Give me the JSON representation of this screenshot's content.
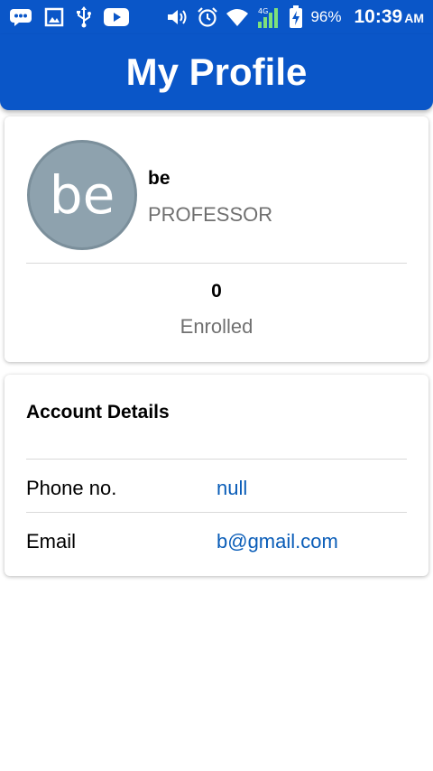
{
  "status_bar": {
    "battery_percent": "96%",
    "time": "10:39",
    "ampm": "AM",
    "signal_label": "4G",
    "icons_left": [
      "message-icon",
      "image-icon",
      "usb-icon",
      "youtube-icon"
    ],
    "icons_right": [
      "volume-icon",
      "alarm-icon",
      "wifi-icon",
      "cell-signal-icon",
      "battery-charging-icon"
    ]
  },
  "appbar": {
    "title": "My Profile"
  },
  "profile": {
    "avatar_initials": "be",
    "name": "be",
    "role": "PROFESSOR",
    "enrolled_count": "0",
    "enrolled_label": "Enrolled"
  },
  "account": {
    "title": "Account Details",
    "rows": [
      {
        "label": "Phone no.",
        "value": "null"
      },
      {
        "label": "Email",
        "value": "b@gmail.com"
      }
    ]
  },
  "colors": {
    "primary": "#0a56c8",
    "link": "#0a5db8",
    "avatar_bg": "#8ea2ae",
    "secondary_text": "#707070"
  }
}
